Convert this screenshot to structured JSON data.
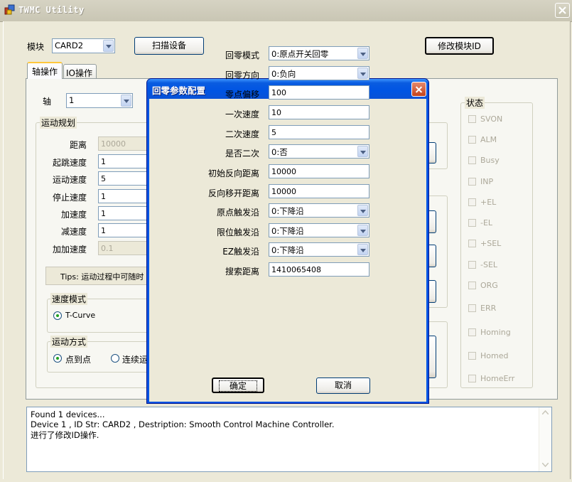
{
  "window": {
    "title": "TWMC Utility"
  },
  "top": {
    "module_label": "模块",
    "module_value": "CARD2",
    "scan_button": "扫描设备",
    "modify_id_button": "修改模块ID"
  },
  "tabs": [
    {
      "label": "轴操作"
    },
    {
      "label": "IO操作"
    }
  ],
  "axis": {
    "label": "轴",
    "value": "1"
  },
  "motion_plan": {
    "title": "运动规划",
    "fields": [
      {
        "label": "距离",
        "value": "10000"
      },
      {
        "label": "起跳速度",
        "value": "1"
      },
      {
        "label": "运动速度",
        "value": "5"
      },
      {
        "label": "停止速度",
        "value": "1"
      },
      {
        "label": "加速度",
        "value": "1"
      },
      {
        "label": "减速度",
        "value": "1"
      },
      {
        "label": "加加速度",
        "value": "0.1"
      }
    ],
    "tips": "Tips: 运动过程中可随时"
  },
  "speed_mode": {
    "title": "速度模式",
    "option": "T-Curve"
  },
  "motion_mode": {
    "title": "运动方式",
    "options": [
      "点到点",
      "连续运"
    ]
  },
  "status": {
    "title": "状态",
    "items": [
      "SVON",
      "ALM",
      "Busy",
      "INP",
      "+EL",
      "-EL",
      "+SEL",
      "-SEL",
      "ORG",
      "ERR",
      "Homing",
      "Homed",
      "HomeErr"
    ]
  },
  "dialog": {
    "title": "回零参数配置",
    "rows": [
      {
        "label": "回零模式",
        "value": "0:原点开关回零"
      },
      {
        "label": "回零方向",
        "value": "0:负向"
      },
      {
        "label": "零点偏移",
        "value": "100"
      },
      {
        "label": "一次速度",
        "value": "10"
      },
      {
        "label": "二次速度",
        "value": "5"
      },
      {
        "label": "是否二次",
        "value": "0:否"
      },
      {
        "label": "初始反向距离",
        "value": "10000"
      },
      {
        "label": "反向移开距离",
        "value": "10000"
      },
      {
        "label": "原点触发沿",
        "value": "0:下降沿"
      },
      {
        "label": "限位触发沿",
        "value": "0:下降沿"
      },
      {
        "label": "EZ触发沿",
        "value": "0:下降沿"
      },
      {
        "label": "搜索距离",
        "value": "1410065408"
      }
    ],
    "ok": "确定",
    "cancel": "取消"
  },
  "log": [
    "Found 1 devices...",
    " Device  1 , ID Str:  CARD2 , Destription: Smooth Control Machine Controller.",
    "进行了修改ID操作."
  ]
}
